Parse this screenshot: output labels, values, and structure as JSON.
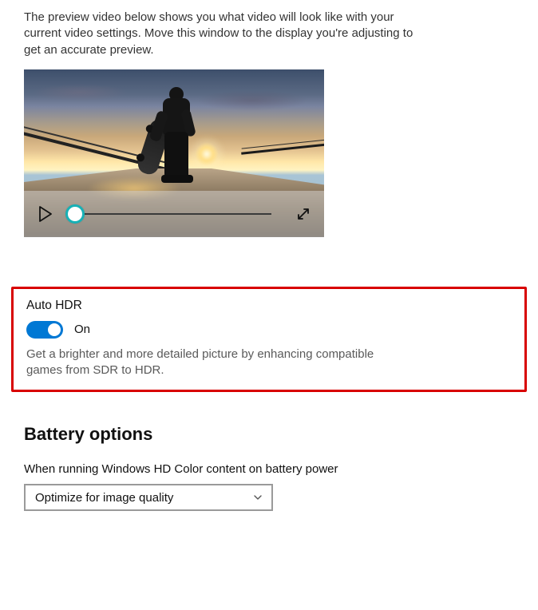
{
  "preview": {
    "description": "The preview video below shows you what video will look like with your current video settings. Move this window to the display you're adjusting to get an accurate preview."
  },
  "autoHdr": {
    "title": "Auto HDR",
    "state_label": "On",
    "enabled": true,
    "description": "Get a brighter and more detailed picture by enhancing compatible games from SDR to HDR."
  },
  "battery": {
    "heading": "Battery options",
    "label": "When running Windows HD Color content on battery power",
    "selected": "Optimize for image quality"
  }
}
